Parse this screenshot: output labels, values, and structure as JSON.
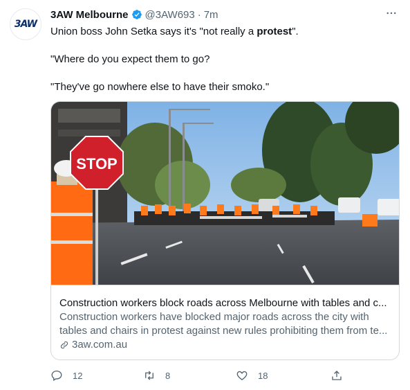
{
  "tweet": {
    "author_name": "3AW Melbourne",
    "handle": "@3AW693",
    "separator": "·",
    "time": "7m",
    "avatar_logo": "3AW",
    "paragraphs": {
      "p1_prefix": "Union boss John Setka says it's \"not really a ",
      "p1_bold": "protest",
      "p1_suffix": "\".",
      "p2": "\"Where do you expect them to go?",
      "p3": "\"They've go nowhere else to have their smoko.\""
    },
    "more_icon": "ellipsis-icon",
    "verified_icon": "verified-badge-icon"
  },
  "card": {
    "image_alt": "Construction workers seated at tables blocking a road, holding a STOP sign",
    "stop_sign_text": "STOP",
    "title": "Construction workers block roads across Melbourne with tables and c...",
    "description_line1": "Construction workers have blocked major roads across the city with",
    "description_line2": "tables and chairs in protest against new rules prohibiting them from te...",
    "domain": "3aw.com.au",
    "domain_icon": "link-icon"
  },
  "actions": {
    "replies": "12",
    "retweets": "8",
    "likes": "18",
    "icons": [
      "reply-icon",
      "retweet-icon",
      "like-icon",
      "share-icon"
    ]
  },
  "colors": {
    "text": "#0f1419",
    "secondary": "#536471",
    "verified": "#1d9bf0",
    "border": "#cfd9de"
  }
}
